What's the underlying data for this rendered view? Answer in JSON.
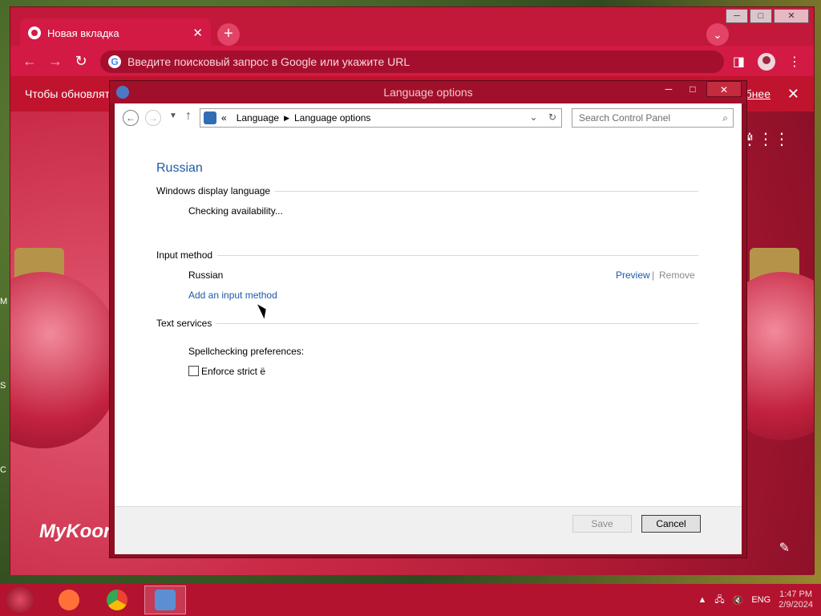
{
  "desktop": {
    "edge_letters": [
      "M",
      "S",
      "C"
    ]
  },
  "chrome": {
    "tab_title": "Новая вкладка",
    "omnibox_placeholder": "Введите поисковый запрос в Google или укажите URL",
    "infobar_text": "Чтобы обновлять",
    "infobar_more": "обнее",
    "page_fragment": "и",
    "brand": "MyKoor",
    "window_controls": [
      "─",
      "□",
      "✕"
    ]
  },
  "dialog": {
    "title": "Language options",
    "breadcrumb": [
      "Language",
      "Language options"
    ],
    "search_placeholder": "Search Control Panel",
    "language_name": "Russian",
    "sections": {
      "display": {
        "heading": "Windows display language",
        "status": "Checking availability..."
      },
      "input": {
        "heading": "Input method",
        "method_name": "Russian",
        "preview_link": "Preview",
        "separator": "|",
        "remove_link": "Remove",
        "add_link": "Add an input method"
      },
      "text": {
        "heading": "Text services",
        "spellcheck_label": "Spellchecking preferences:",
        "enforce_label": "Enforce strict ё",
        "enforce_checked": false
      }
    },
    "buttons": {
      "save": "Save",
      "cancel": "Cancel"
    }
  },
  "taskbar": {
    "language": "ENG",
    "time": "1:47 PM",
    "date": "2/9/2024",
    "apps": [
      {
        "name": "firefox",
        "color": "#ff7139"
      },
      {
        "name": "chrome",
        "color": "#4285f4"
      },
      {
        "name": "control-panel",
        "color": "#5b8fd1"
      }
    ]
  }
}
